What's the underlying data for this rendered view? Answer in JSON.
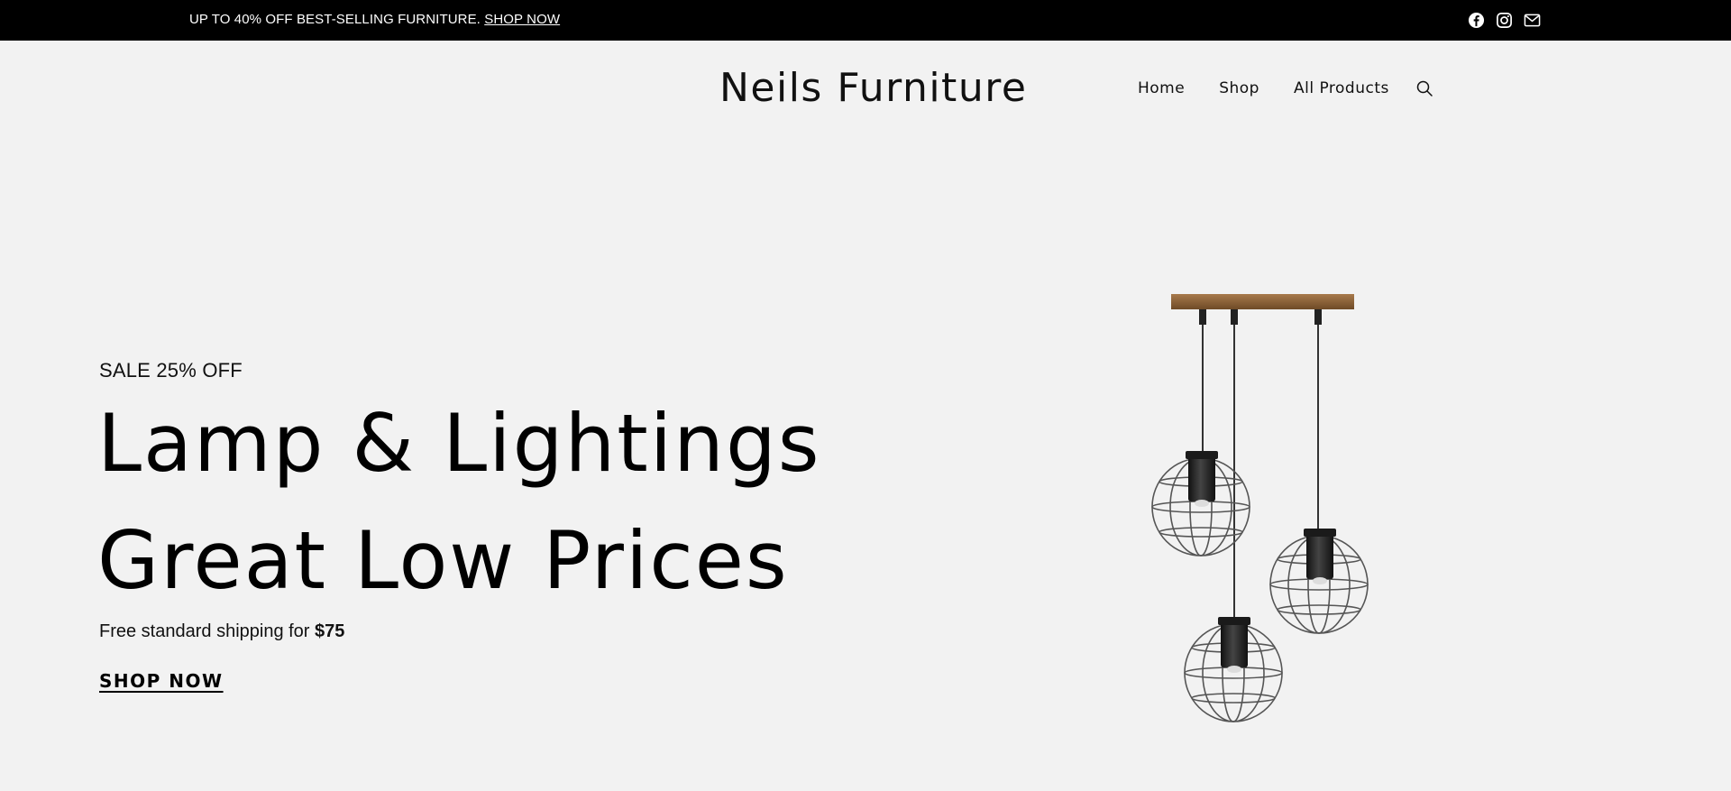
{
  "topbar": {
    "promo_text": "UP TO 40% OFF BEST-SELLING FURNITURE.",
    "promo_link": "SHOP NOW",
    "socials": [
      "facebook-icon",
      "instagram-icon",
      "mail-icon"
    ]
  },
  "header": {
    "brand": "Neils Furniture",
    "nav": [
      "Home",
      "Shop",
      "All Products"
    ],
    "search_icon": "search-icon"
  },
  "hero": {
    "subtitle": "SALE 25% OFF",
    "title_line1": "Lamp & Lightings",
    "title_line2": "Great Low Prices",
    "shipping_text": "Free standard shipping for ",
    "shipping_amount": "$75",
    "cta": "SHOP NOW",
    "image": "pendant-lamp-image"
  },
  "colors": {
    "topbar_bg": "#000000",
    "page_bg": "#f2f2f2",
    "wood": "#8b6239"
  }
}
